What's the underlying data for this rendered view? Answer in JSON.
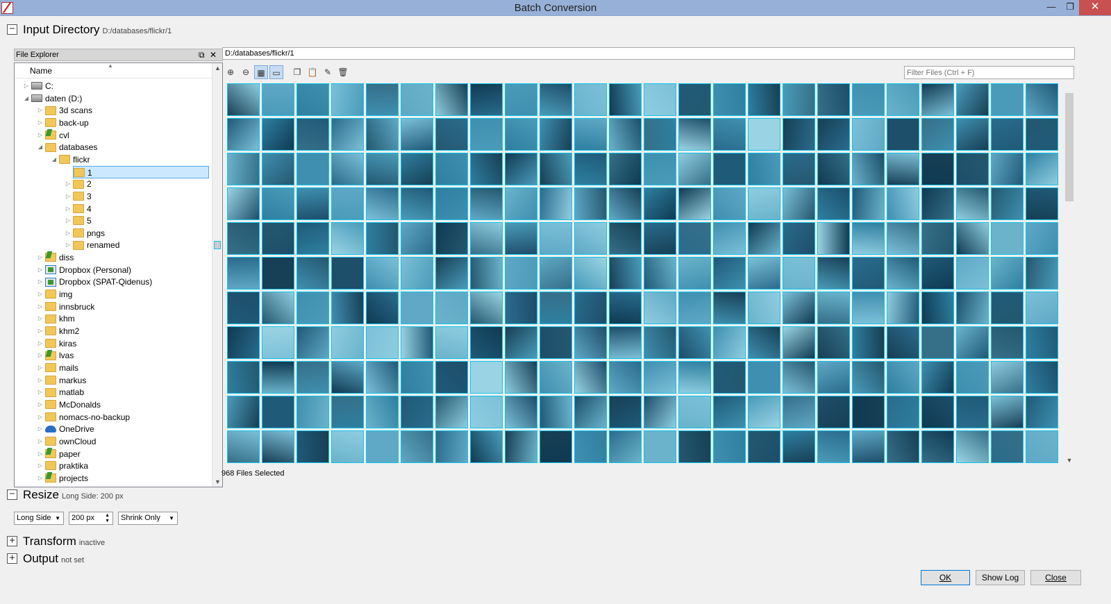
{
  "window": {
    "title": "Batch Conversion",
    "minimize_glyph": "—",
    "maximize_glyph": "❐",
    "close_glyph": "✕"
  },
  "sections": {
    "input": {
      "title": "Input Directory",
      "subtitle": "D:/databases/flickr/1",
      "toggle": "−"
    },
    "resize": {
      "title": "Resize",
      "subtitle": "Long Side: 200 px",
      "toggle": "−"
    },
    "transform": {
      "title": "Transform",
      "subtitle": "inactive",
      "toggle": "+"
    },
    "output": {
      "title": "Output",
      "subtitle": "not set",
      "toggle": "+"
    }
  },
  "explorer": {
    "title": "File Explorer",
    "column": "Name",
    "float_glyph": "⧉",
    "close_glyph": "✕",
    "items": [
      {
        "label": "C:",
        "icon": "drive-icon",
        "depth": 0,
        "arrow": "▷"
      },
      {
        "label": "daten (D:)",
        "icon": "drive-icon",
        "depth": 0,
        "arrow": "◢"
      },
      {
        "label": "3d scans",
        "icon": "folder-icon",
        "depth": 1,
        "arrow": "▷"
      },
      {
        "label": "back-up",
        "icon": "folder-icon",
        "depth": 1,
        "arrow": "▷"
      },
      {
        "label": "cvl",
        "icon": "folder-green-icon",
        "depth": 1,
        "arrow": "▷"
      },
      {
        "label": "databases",
        "icon": "folder-icon",
        "depth": 1,
        "arrow": "◢"
      },
      {
        "label": "flickr",
        "icon": "folder-icon",
        "depth": 2,
        "arrow": "◢"
      },
      {
        "label": "1",
        "icon": "folder-icon",
        "depth": 3,
        "arrow": "",
        "selected": true
      },
      {
        "label": "2",
        "icon": "folder-icon",
        "depth": 3,
        "arrow": "▷"
      },
      {
        "label": "3",
        "icon": "folder-icon",
        "depth": 3,
        "arrow": "▷"
      },
      {
        "label": "4",
        "icon": "folder-icon",
        "depth": 3,
        "arrow": "▷"
      },
      {
        "label": "5",
        "icon": "folder-icon",
        "depth": 3,
        "arrow": "▷"
      },
      {
        "label": "pngs",
        "icon": "folder-icon",
        "depth": 3,
        "arrow": "▷"
      },
      {
        "label": "renamed",
        "icon": "folder-icon",
        "depth": 3,
        "arrow": "▷"
      },
      {
        "label": "diss",
        "icon": "folder-green-icon",
        "depth": 1,
        "arrow": "▷"
      },
      {
        "label": "Dropbox (Personal)",
        "icon": "dropbox-icon",
        "depth": 1,
        "arrow": "▷"
      },
      {
        "label": "Dropbox (SPAT-Qidenus)",
        "icon": "dropbox-icon",
        "depth": 1,
        "arrow": "▷"
      },
      {
        "label": "img",
        "icon": "folder-icon",
        "depth": 1,
        "arrow": "▷"
      },
      {
        "label": "innsbruck",
        "icon": "folder-icon",
        "depth": 1,
        "arrow": "▷"
      },
      {
        "label": "khm",
        "icon": "folder-icon",
        "depth": 1,
        "arrow": "▷"
      },
      {
        "label": "khm2",
        "icon": "folder-icon",
        "depth": 1,
        "arrow": "▷"
      },
      {
        "label": "kiras",
        "icon": "folder-icon",
        "depth": 1,
        "arrow": "▷"
      },
      {
        "label": "lvas",
        "icon": "folder-green-icon",
        "depth": 1,
        "arrow": "▷"
      },
      {
        "label": "mails",
        "icon": "folder-icon",
        "depth": 1,
        "arrow": "▷"
      },
      {
        "label": "markus",
        "icon": "folder-icon",
        "depth": 1,
        "arrow": "▷"
      },
      {
        "label": "matlab",
        "icon": "folder-icon",
        "depth": 1,
        "arrow": "▷"
      },
      {
        "label": "McDonalds",
        "icon": "folder-icon",
        "depth": 1,
        "arrow": "▷"
      },
      {
        "label": "nomacs-no-backup",
        "icon": "folder-icon",
        "depth": 1,
        "arrow": "▷"
      },
      {
        "label": "OneDrive",
        "icon": "cloud-icon",
        "depth": 1,
        "arrow": "▷"
      },
      {
        "label": "ownCloud",
        "icon": "folder-icon",
        "depth": 1,
        "arrow": "▷"
      },
      {
        "label": "paper",
        "icon": "folder-green-icon",
        "depth": 1,
        "arrow": "▷"
      },
      {
        "label": "praktika",
        "icon": "folder-icon",
        "depth": 1,
        "arrow": "▷"
      },
      {
        "label": "projects",
        "icon": "folder-green-icon",
        "depth": 1,
        "arrow": "▷"
      }
    ]
  },
  "path_bar": {
    "value": "D:/databases/flickr/1"
  },
  "toolbar": {
    "buttons": [
      {
        "name": "zoom-in-icon",
        "glyph": "⊕"
      },
      {
        "name": "zoom-out-icon",
        "glyph": "⊖"
      },
      {
        "name": "grid-view-icon",
        "glyph": "▦",
        "active": true
      },
      {
        "name": "single-view-icon",
        "glyph": "▭",
        "active": true
      },
      {
        "name": "copy-icon",
        "glyph": "❐"
      },
      {
        "name": "paste-icon",
        "glyph": "📋"
      },
      {
        "name": "rename-icon",
        "glyph": "✎"
      },
      {
        "name": "delete-icon",
        "glyph": "🗑"
      }
    ]
  },
  "filter": {
    "placeholder": "Filter Files (Ctrl + F)"
  },
  "thumbnails": {
    "selection_color": "#11c4e8"
  },
  "status": {
    "text": "968 Files Selected"
  },
  "resize": {
    "mode": "Long Side",
    "size": "200 px",
    "policy": "Shrink Only"
  },
  "dialog_buttons": {
    "ok": "OK",
    "show_log": "Show Log",
    "close": "Close"
  }
}
